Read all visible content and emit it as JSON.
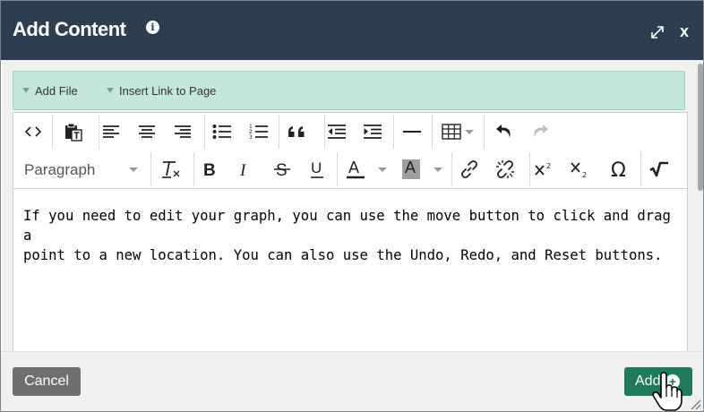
{
  "dialog": {
    "title": "Add Content",
    "info_icon": "info-icon",
    "close_label": "x"
  },
  "file_bar": {
    "add_file": "Add File",
    "insert_link": "Insert Link to Page"
  },
  "toolbar": {
    "format_select": "Paragraph",
    "icons_row1": [
      "code-icon",
      "paste-text-icon",
      "align-left-icon",
      "align-center-icon",
      "align-right-icon",
      "bullet-list-icon",
      "numbered-list-icon",
      "blockquote-icon",
      "outdent-icon",
      "indent-icon",
      "horizontal-rule-icon",
      "table-icon",
      "undo-icon",
      "redo-icon"
    ],
    "icons_row2": [
      "clear-format-icon",
      "bold-icon",
      "italic-icon",
      "strikethrough-icon",
      "underline-icon",
      "text-color-icon",
      "background-color-icon",
      "link-icon",
      "unlink-icon",
      "superscript-icon",
      "subscript-icon",
      "omega-icon",
      "math-icon"
    ],
    "btn_text_color": "A",
    "btn_bg_color": "A"
  },
  "content": {
    "text": "If you need to edit your graph, you can use the move button to click and drag a\npoint to a new location. You can also use the Undo, Redo, and Reset buttons."
  },
  "footer": {
    "cancel_label": "Cancel",
    "add_label": "Add",
    "add_icon": "+"
  },
  "colors": {
    "header_bg": "#2c3e50",
    "file_bar_bg": "#c3e6dd",
    "add_button": "#1f7a5c",
    "cancel_button": "#6f6f6f"
  }
}
